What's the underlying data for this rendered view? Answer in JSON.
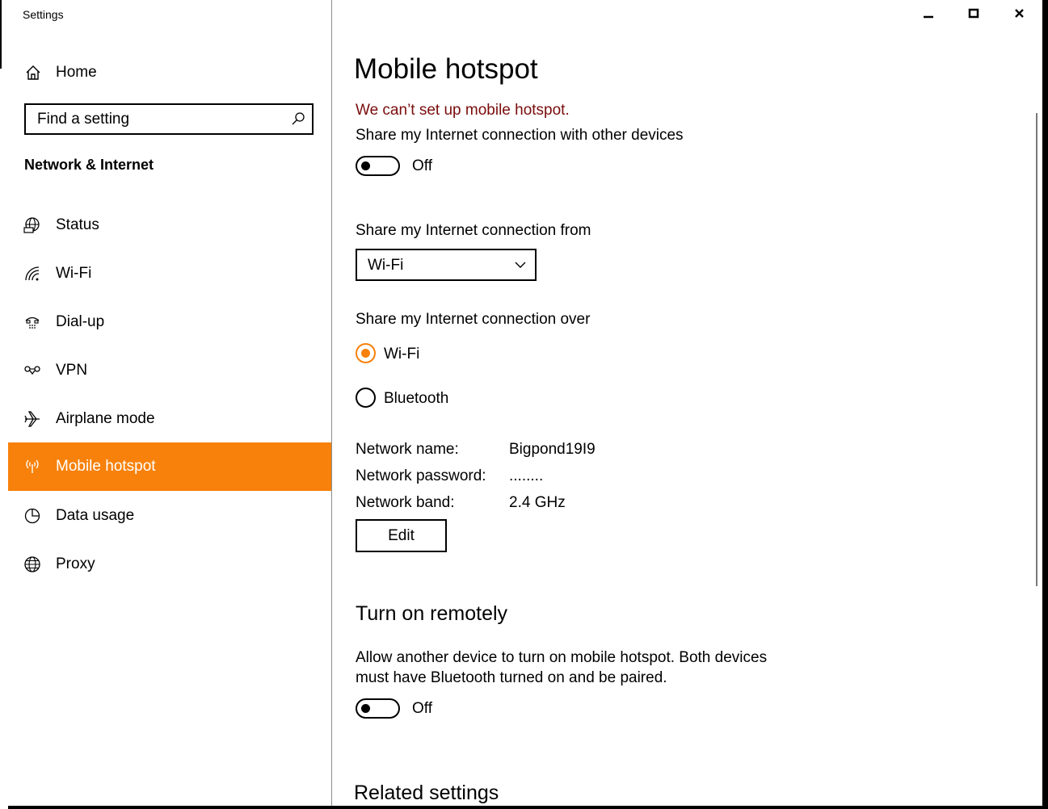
{
  "window": {
    "title": "Settings",
    "controls": {
      "minimize": "minimize",
      "maximize": "maximize",
      "close": "close"
    }
  },
  "sidebar": {
    "home_label": "Home",
    "search_placeholder": "Find a setting",
    "section_title": "Network & Internet",
    "items": [
      {
        "label": "Status",
        "icon": "globe-monitor-icon",
        "selected": false
      },
      {
        "label": "Wi-Fi",
        "icon": "wifi-icon",
        "selected": false
      },
      {
        "label": "Dial-up",
        "icon": "dialup-icon",
        "selected": false
      },
      {
        "label": "VPN",
        "icon": "vpn-icon",
        "selected": false
      },
      {
        "label": "Airplane mode",
        "icon": "airplane-icon",
        "selected": false
      },
      {
        "label": "Mobile hotspot",
        "icon": "hotspot-icon",
        "selected": true
      },
      {
        "label": "Data usage",
        "icon": "data-usage-icon",
        "selected": false
      },
      {
        "label": "Proxy",
        "icon": "proxy-globe-icon",
        "selected": false
      }
    ]
  },
  "colors": {
    "accent": "#f7810b",
    "error": "#7a0c0c"
  },
  "main": {
    "title": "Mobile hotspot",
    "error_message": "We can’t set up mobile hotspot.",
    "share_label": "Share my Internet connection with other devices",
    "share_toggle_state": "Off",
    "from_label": "Share my Internet connection from",
    "from_value": "Wi-Fi",
    "over_label": "Share my Internet connection over",
    "over_options": [
      {
        "label": "Wi-Fi",
        "selected": true
      },
      {
        "label": "Bluetooth",
        "selected": false
      }
    ],
    "network": {
      "name_label": "Network name:",
      "name_value": "Bigpond19I9",
      "password_label": "Network password:",
      "password_value": "........",
      "band_label": "Network band:",
      "band_value": "2.4 GHz"
    },
    "edit_label": "Edit",
    "remote_title": "Turn on remotely",
    "remote_desc_line1": "Allow another device to turn on mobile hotspot. Both devices",
    "remote_desc_line2": "must have Bluetooth turned on and be paired.",
    "remote_toggle_state": "Off",
    "related_title": "Related settings"
  }
}
